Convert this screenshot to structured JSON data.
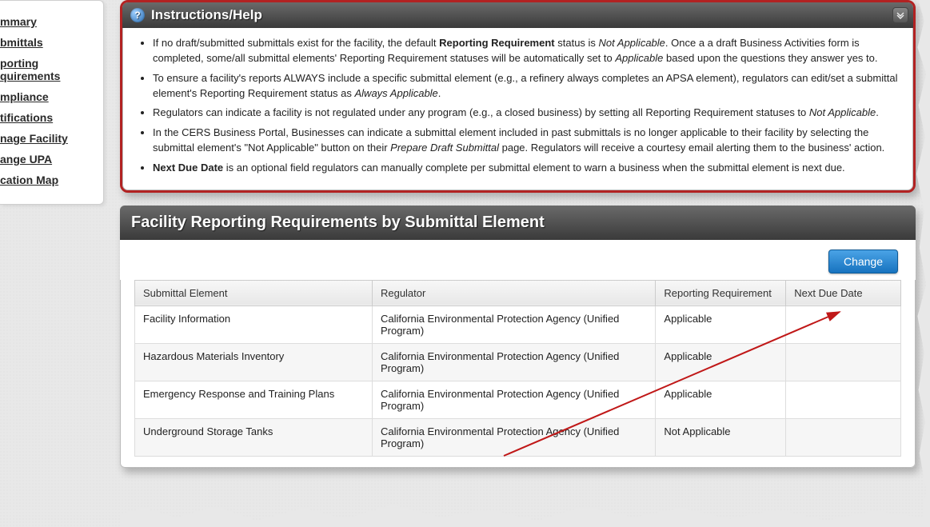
{
  "sidebar": {
    "items": [
      {
        "label": "mmary"
      },
      {
        "label": "bmittals"
      },
      {
        "label": "porting quirements"
      },
      {
        "label": "mpliance"
      },
      {
        "label": "tifications"
      },
      {
        "label": "nage Facility"
      },
      {
        "label": "ange UPA"
      },
      {
        "label": "cation Map"
      }
    ]
  },
  "help": {
    "title": "Instructions/Help",
    "bullets": [
      {
        "parts": [
          {
            "t": "If no draft/submitted submittals exist for the facility, the default "
          },
          {
            "t": "Reporting Requirement",
            "b": true
          },
          {
            "t": " status is "
          },
          {
            "t": "Not Applicable",
            "i": true
          },
          {
            "t": ". Once a a draft Business Activities form is completed, some/all submittal elements' Reporting Requirement statuses will be automatically set to "
          },
          {
            "t": "Applicable",
            "i": true
          },
          {
            "t": " based upon the questions they answer yes to."
          }
        ]
      },
      {
        "parts": [
          {
            "t": "To ensure a facility's reports ALWAYS include a specific submittal element (e.g., a refinery always completes an APSA element), regulators can edit/set a submittal element's Reporting Requirement status as "
          },
          {
            "t": "Always Applicable",
            "i": true
          },
          {
            "t": "."
          }
        ]
      },
      {
        "parts": [
          {
            "t": "Regulators can indicate a facility is not regulated under any program (e.g., a closed business) by setting all Reporting Requirement statuses to "
          },
          {
            "t": "Not Applicable",
            "i": true
          },
          {
            "t": "."
          }
        ]
      },
      {
        "parts": [
          {
            "t": "In the CERS Business Portal, Businesses can indicate a submittal element included in past submittals is no longer applicable to their facility by selecting the submittal element's \"Not Applicable\" button on their "
          },
          {
            "t": "Prepare Draft Submittal",
            "i": true
          },
          {
            "t": " page. Regulators will receive a courtesy email alerting them to the business' action."
          }
        ]
      },
      {
        "parts": [
          {
            "t": "Next Due Date",
            "b": true
          },
          {
            "t": " is an optional field regulators can manually complete per submittal element to warn a business when the submittal element is next due."
          }
        ]
      }
    ]
  },
  "tablePanel": {
    "title": "Facility Reporting Requirements by Submittal Element",
    "changeLabel": "Change",
    "columns": [
      "Submittal Element",
      "Regulator",
      "Reporting Requirement",
      "Next Due Date"
    ],
    "rows": [
      {
        "element": "Facility Information",
        "regulator": "California Environmental Protection Agency (Unified Program)",
        "req": "Applicable",
        "due": ""
      },
      {
        "element": "Hazardous Materials Inventory",
        "regulator": "California Environmental Protection Agency (Unified Program)",
        "req": "Applicable",
        "due": ""
      },
      {
        "element": "Emergency Response and Training Plans",
        "regulator": "California Environmental Protection Agency (Unified Program)",
        "req": "Applicable",
        "due": ""
      },
      {
        "element": "Underground Storage Tanks",
        "regulator": "California Environmental Protection Agency (Unified Program)",
        "req": "Not Applicable",
        "due": ""
      }
    ]
  }
}
